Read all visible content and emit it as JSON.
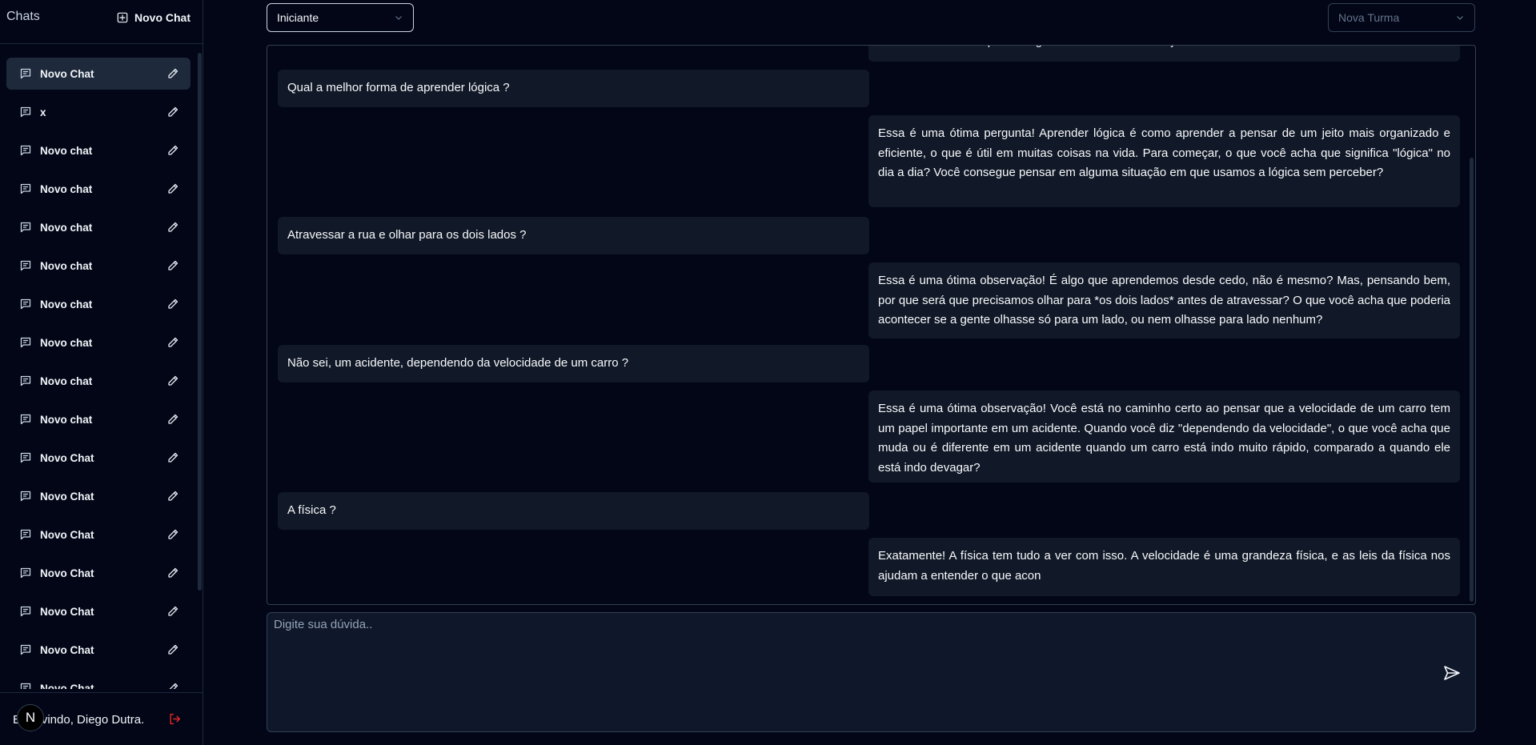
{
  "sidebar": {
    "title": "Chats",
    "new_chat_label": "Novo Chat",
    "items": [
      {
        "label": "Novo Chat",
        "active": true
      },
      {
        "label": "x"
      },
      {
        "label": "Novo chat"
      },
      {
        "label": "Novo chat"
      },
      {
        "label": "Novo chat"
      },
      {
        "label": "Novo chat"
      },
      {
        "label": "Novo chat"
      },
      {
        "label": "Novo chat"
      },
      {
        "label": "Novo chat"
      },
      {
        "label": "Novo chat"
      },
      {
        "label": "Novo Chat"
      },
      {
        "label": "Novo Chat"
      },
      {
        "label": "Novo Chat"
      },
      {
        "label": "Novo Chat"
      },
      {
        "label": "Novo Chat"
      },
      {
        "label": "Novo Chat"
      },
      {
        "label": "Novo Chat"
      }
    ],
    "footer": {
      "welcome": "Bem-vindo, Diego Dutra.",
      "avatar_letter": "N",
      "logout_icon": "logout-icon"
    }
  },
  "header": {
    "level_select": {
      "value": "Iniciante"
    },
    "turma_select": {
      "value": "Nova Turma"
    }
  },
  "messages": [
    {
      "role": "ai",
      "text": "o tema ou a dúvida que você gostaria de desvendar hoje?"
    },
    {
      "role": "user",
      "text": "Qual a melhor forma de aprender lógica ?"
    },
    {
      "role": "ai",
      "text": "Essa é uma ótima pergunta! Aprender lógica é como aprender a pensar de um jeito mais organizado e eficiente, o que é útil em muitas coisas na vida. Para começar, o que você acha que significa \"lógica\" no dia a dia? Você consegue pensar em alguma situação em que usamos a lógica sem perceber?"
    },
    {
      "role": "user",
      "text": "Atravessar a rua e olhar para os dois lados ?"
    },
    {
      "role": "ai",
      "text": "Essa é uma ótima observação! É algo que aprendemos desde cedo, não é mesmo? Mas, pensando bem, por que será que precisamos olhar para *os dois lados* antes de atravessar? O que você acha que poderia acontecer se a gente olhasse só para um lado, ou nem olhasse para lado nenhum?"
    },
    {
      "role": "user",
      "text": "Não sei, um acidente, dependendo da velocidade de um carro ?"
    },
    {
      "role": "ai",
      "text": "Essa é uma ótima observação! Você está no caminho certo ao pensar que a velocidade de um carro tem um papel importante em um acidente. Quando você diz \"dependendo da velocidade\", o que você acha que muda ou é diferente em um acidente quando um carro está indo muito rápido, comparado a quando ele está indo devagar?"
    },
    {
      "role": "user",
      "text": "A física ?"
    },
    {
      "role": "ai",
      "text": "Exatamente! A física tem tudo a ver com isso. A velocidade é uma grandeza física, e as leis da física nos ajudam a entender o que acon"
    }
  ],
  "input": {
    "placeholder": "Digite sua dúvida..",
    "value": ""
  }
}
